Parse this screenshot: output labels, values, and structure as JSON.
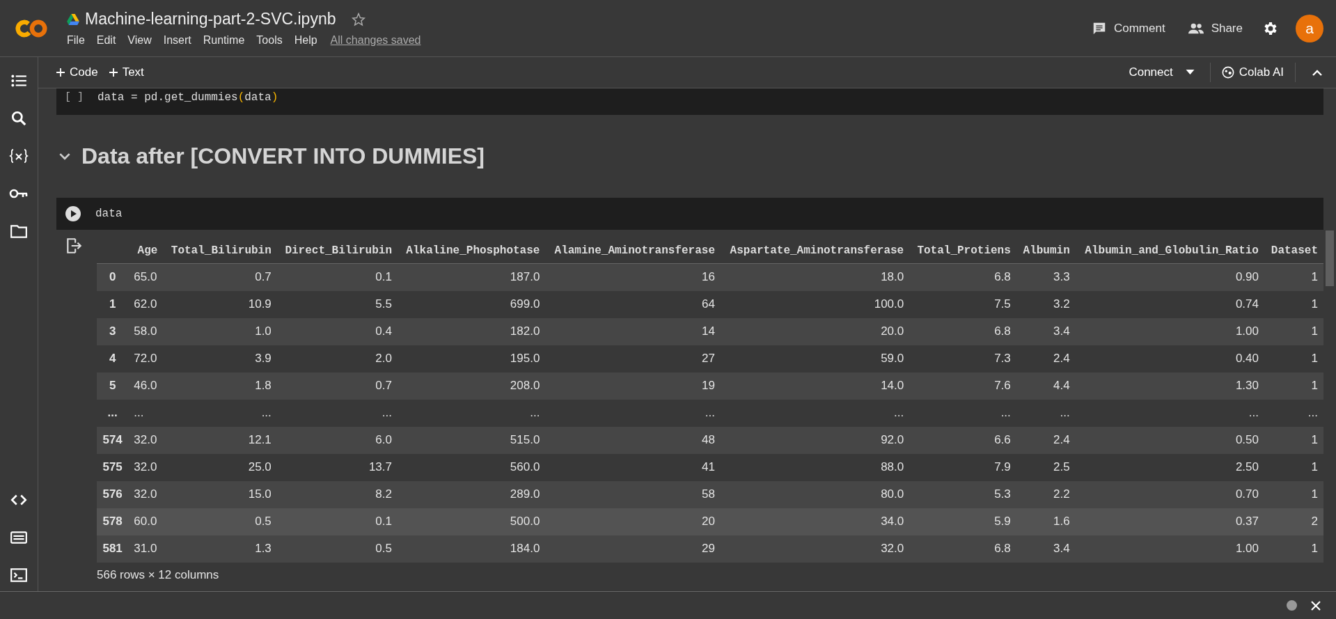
{
  "header": {
    "title": "Machine-learning-part-2-SVC.ipynb",
    "starred": false,
    "menu": [
      "File",
      "Edit",
      "View",
      "Insert",
      "Runtime",
      "Tools",
      "Help"
    ],
    "save_status": "All changes saved",
    "actions": [
      {
        "label": "Comment",
        "kind": "comment"
      },
      {
        "label": "Share",
        "kind": "share"
      }
    ],
    "avatar": "a"
  },
  "toolbar": {
    "add_buttons": [
      "Code",
      "Text"
    ],
    "connect": "Connect",
    "ai": "Colab AI"
  },
  "cells": [
    {
      "kind": "code",
      "prompt": "[ ]",
      "tokens": [
        {
          "text": "data = pd.get_dummies",
          "kind": "plain"
        },
        {
          "text": "(",
          "kind": "paren"
        },
        {
          "text": "data",
          "kind": "plain"
        },
        {
          "text": ")",
          "kind": "paren"
        }
      ]
    },
    {
      "kind": "heading",
      "text": "Data after [CONVERT INTO DUMMIES]",
      "expanded": true
    },
    {
      "kind": "run",
      "tokens": [
        {
          "text": "data",
          "kind": "plain"
        }
      ],
      "output": {
        "columns": [
          "Age",
          "Total_Bilirubin",
          "Direct_Bilirubin",
          "Alkaline_Phosphotase",
          "Alamine_Aminotransferase",
          "Aspartate_Aminotransferase",
          "Total_Protiens",
          "Albumin",
          "Albumin_and_Globulin_Ratio",
          "Dataset"
        ],
        "rows": [
          {
            "index": "0",
            "highlighted": false,
            "cells": [
              "65.0",
              "0.7",
              "0.1",
              "187.0",
              "16",
              "18.0",
              "6.8",
              "3.3",
              "0.90",
              "1"
            ]
          },
          {
            "index": "1",
            "highlighted": false,
            "cells": [
              "62.0",
              "10.9",
              "5.5",
              "699.0",
              "64",
              "100.0",
              "7.5",
              "3.2",
              "0.74",
              "1"
            ]
          },
          {
            "index": "3",
            "highlighted": false,
            "cells": [
              "58.0",
              "1.0",
              "0.4",
              "182.0",
              "14",
              "20.0",
              "6.8",
              "3.4",
              "1.00",
              "1"
            ]
          },
          {
            "index": "4",
            "highlighted": false,
            "cells": [
              "72.0",
              "3.9",
              "2.0",
              "195.0",
              "27",
              "59.0",
              "7.3",
              "2.4",
              "0.40",
              "1"
            ]
          },
          {
            "index": "5",
            "highlighted": false,
            "cells": [
              "46.0",
              "1.8",
              "0.7",
              "208.0",
              "19",
              "14.0",
              "7.6",
              "4.4",
              "1.30",
              "1"
            ]
          },
          {
            "index": "...",
            "highlighted": false,
            "cells": [
              "...",
              "...",
              "...",
              "...",
              "...",
              "...",
              "...",
              "...",
              "...",
              "..."
            ]
          },
          {
            "index": "574",
            "highlighted": false,
            "cells": [
              "32.0",
              "12.1",
              "6.0",
              "515.0",
              "48",
              "92.0",
              "6.6",
              "2.4",
              "0.50",
              "1"
            ]
          },
          {
            "index": "575",
            "highlighted": false,
            "cells": [
              "32.0",
              "25.0",
              "13.7",
              "560.0",
              "41",
              "88.0",
              "7.9",
              "2.5",
              "2.50",
              "1"
            ]
          },
          {
            "index": "576",
            "highlighted": false,
            "cells": [
              "32.0",
              "15.0",
              "8.2",
              "289.0",
              "58",
              "80.0",
              "5.3",
              "2.2",
              "0.70",
              "1"
            ]
          },
          {
            "index": "578",
            "highlighted": true,
            "cells": [
              "60.0",
              "0.5",
              "0.1",
              "500.0",
              "20",
              "34.0",
              "5.9",
              "1.6",
              "0.37",
              "2"
            ]
          },
          {
            "index": "581",
            "highlighted": false,
            "cells": [
              "31.0",
              "1.3",
              "0.5",
              "184.0",
              "29",
              "32.0",
              "6.8",
              "3.4",
              "1.00",
              "1"
            ]
          }
        ],
        "shape": "566 rows × 12 columns"
      }
    }
  ]
}
